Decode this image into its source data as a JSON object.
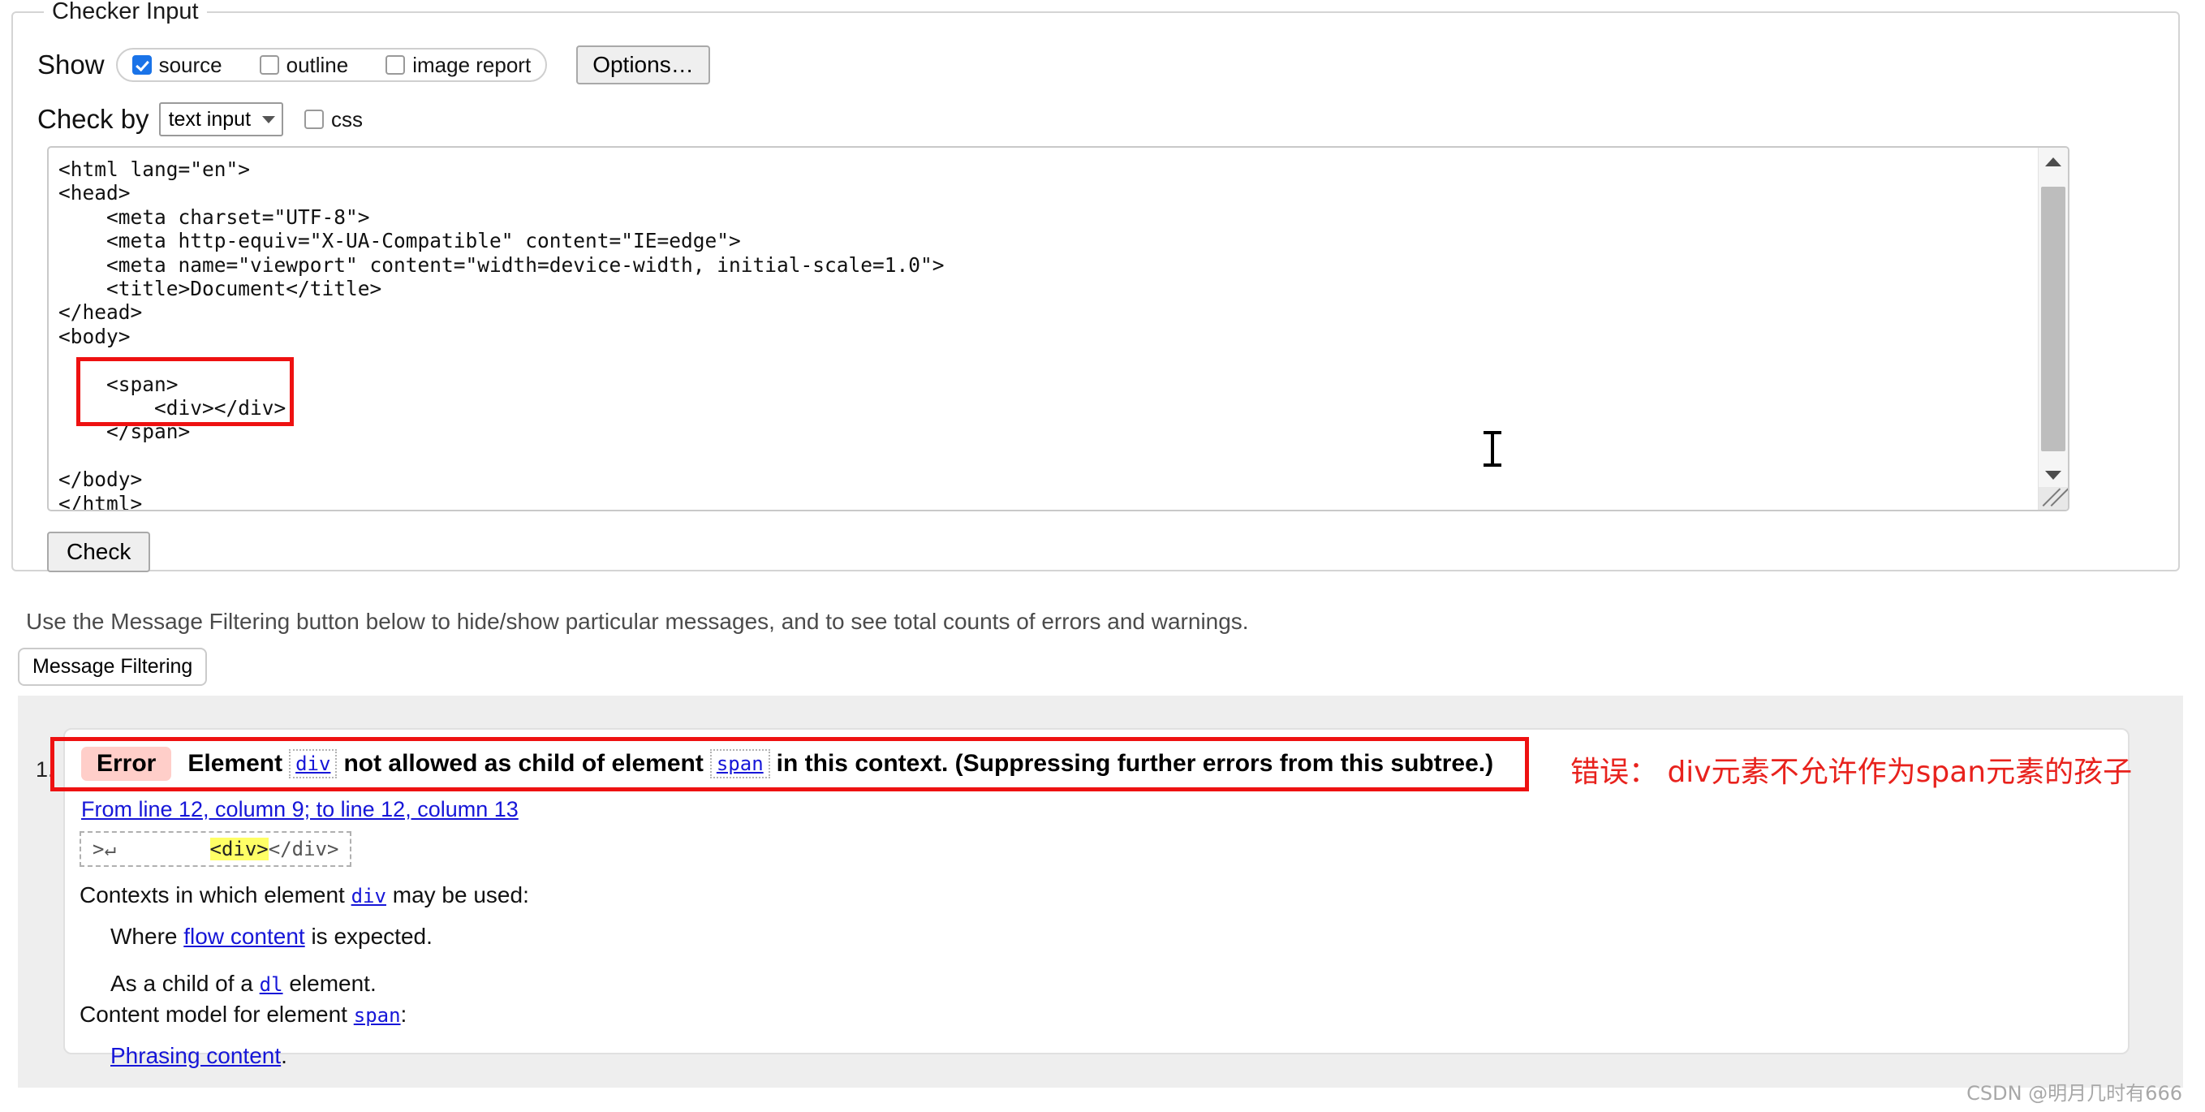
{
  "checker": {
    "legend": "Checker Input",
    "show_label": "Show",
    "show_options": [
      {
        "label": "source",
        "checked": true
      },
      {
        "label": "outline",
        "checked": false
      },
      {
        "label": "image report",
        "checked": false
      }
    ],
    "options_button": "Options…",
    "check_by_label": "Check by",
    "check_by_value": "text input",
    "css_checkbox_label": "css",
    "css_checked": false,
    "check_button": "Check",
    "source": "<html lang=\"en\">\n<head>\n    <meta charset=\"UTF-8\">\n    <meta http-equiv=\"X-UA-Compatible\" content=\"IE=edge\">\n    <meta name=\"viewport\" content=\"width=device-width, initial-scale=1.0\">\n    <title>Document</title>\n</head>\n<body>\n\n    <span>\n        <div></div>\n    </span>\n\n</body>\n</html>"
  },
  "filtering": {
    "note": "Use the Message Filtering button below to hide/show particular messages, and to see total counts of errors and warnings.",
    "button": "Message Filtering"
  },
  "results": {
    "index": "1.",
    "badge": "Error",
    "msg_part1": "Element",
    "msg_elem1": "div",
    "msg_part2": "not allowed as child of element",
    "msg_elem2": "span",
    "msg_part3": "in this context. (Suppressing further errors from this subtree.)",
    "location_link": "From line 12, column 9; to line 12, column 13",
    "extract_prefix": ">↵",
    "extract_gap": "        ",
    "extract_highlight": "<div>",
    "extract_suffix": "</div>",
    "contexts_line1_a": "Contexts in which element",
    "contexts_line1_elem": "div",
    "contexts_line1_b": "may be used:",
    "contexts_line2_a": "Where",
    "contexts_line2_link": "flow content",
    "contexts_line2_b": "is expected.",
    "contexts_line3_a": "As a child of a",
    "contexts_line3_elem": "dl",
    "contexts_line3_b": "element.",
    "contexts_line4_a": "Content model for element",
    "contexts_line4_elem": "span",
    "contexts_line4_b": ":",
    "contexts_line5_link": "Phrasing content",
    "contexts_line5_b": "."
  },
  "annotation": {
    "chinese_note": "错误： div元素不允许作为span元素的孩子",
    "color": "#e8221d"
  },
  "watermark": "CSDN @明月几时有666"
}
